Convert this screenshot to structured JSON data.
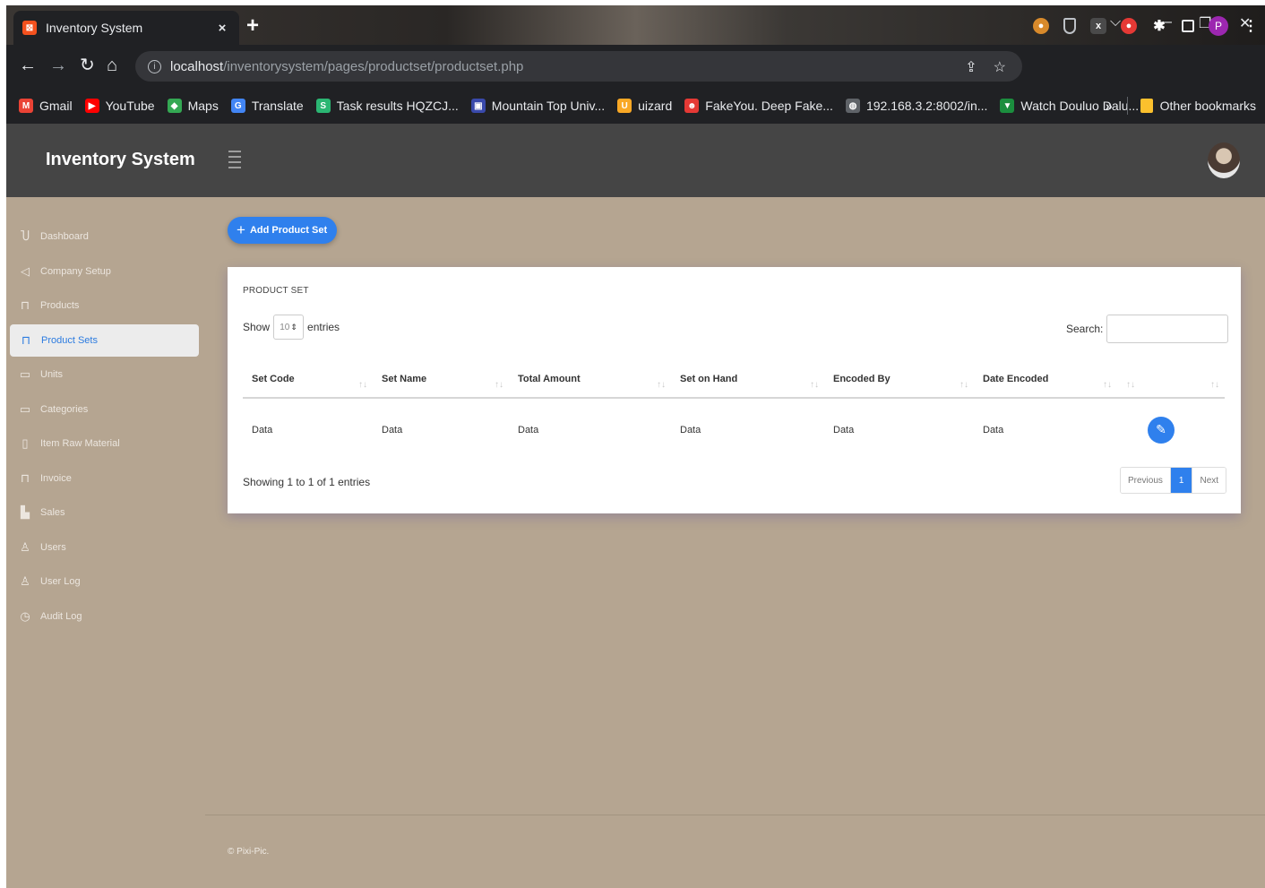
{
  "browser": {
    "tab_title": "Inventory System",
    "tab_close": "×",
    "new_tab": "+",
    "url_host": "localhost",
    "url_path": "/inventorysystem/pages/productset/productset.php",
    "bookmarks": [
      {
        "label": "Gmail",
        "icon": "gmail-icon",
        "color": "#ea4335",
        "glyph": "M"
      },
      {
        "label": "YouTube",
        "icon": "youtube-icon",
        "color": "#ff0000",
        "glyph": "▶"
      },
      {
        "label": "Maps",
        "icon": "maps-icon",
        "color": "#34a853",
        "glyph": "◆"
      },
      {
        "label": "Translate",
        "icon": "translate-icon",
        "color": "#4285f4",
        "glyph": "G"
      },
      {
        "label": "Task results HQZCJ...",
        "icon": "task-results-icon",
        "color": "#2bb673",
        "glyph": "S"
      },
      {
        "label": "Mountain Top Univ...",
        "icon": "university-icon",
        "color": "#3949ab",
        "glyph": "▣"
      },
      {
        "label": "uizard",
        "icon": "uizard-icon",
        "color": "#f9a825",
        "glyph": "U"
      },
      {
        "label": "FakeYou. Deep Fake...",
        "icon": "fakeyou-icon",
        "color": "#e53935",
        "glyph": "☻"
      },
      {
        "label": "192.168.3.2:8002/in...",
        "icon": "globe-icon",
        "color": "#5f6368",
        "glyph": "◍"
      },
      {
        "label": "Watch Douluo Dalu...",
        "icon": "watch-icon",
        "color": "#1b8e3e",
        "glyph": "▼"
      }
    ],
    "bookmarks_overflow": "»",
    "other_bookmarks": "Other bookmarks",
    "profile_initial": "P"
  },
  "app": {
    "brand": "Inventory System",
    "sidebar": [
      {
        "label": "Dashboard",
        "icon": "dashboard-icon",
        "glyph": "Ⴎ"
      },
      {
        "label": "Company Setup",
        "icon": "company-icon",
        "glyph": "◁"
      },
      {
        "label": "Products",
        "icon": "cart-icon",
        "glyph": "⊓"
      },
      {
        "label": "Product Sets",
        "icon": "cart-icon",
        "glyph": "⊓"
      },
      {
        "label": "Units",
        "icon": "units-icon",
        "glyph": "▭"
      },
      {
        "label": "Categories",
        "icon": "categories-icon",
        "glyph": "▭"
      },
      {
        "label": "Item Raw Material",
        "icon": "document-icon",
        "glyph": "▯"
      },
      {
        "label": "Invoice",
        "icon": "invoice-icon",
        "glyph": "⊓"
      },
      {
        "label": "Sales",
        "icon": "bar-chart-icon",
        "glyph": "▙"
      },
      {
        "label": "Users",
        "icon": "user-icon",
        "glyph": "♙"
      },
      {
        "label": "User Log",
        "icon": "user-icon",
        "glyph": "♙"
      },
      {
        "label": "Audit Log",
        "icon": "clock-icon",
        "glyph": "◷"
      }
    ],
    "active_index": 3,
    "add_button": "Add Product Set",
    "card_title": "PRODUCT SET",
    "show_label": "Show",
    "entries_value": "10",
    "entries_label": "entries",
    "search_label": "Search:",
    "columns": [
      "Set Code",
      "Set Name",
      "Total Amount",
      "Set on Hand",
      "Encoded By",
      "Date Encoded",
      ""
    ],
    "rows": [
      [
        "Data",
        "Data",
        "Data",
        "Data",
        "Data",
        "Data"
      ]
    ],
    "info": "Showing 1 to 1 of 1 entries",
    "pagination": {
      "previous": "Previous",
      "current": "1",
      "next": "Next"
    },
    "footer": "© Pixi-Pic.",
    "accent": "#2f80ed"
  }
}
